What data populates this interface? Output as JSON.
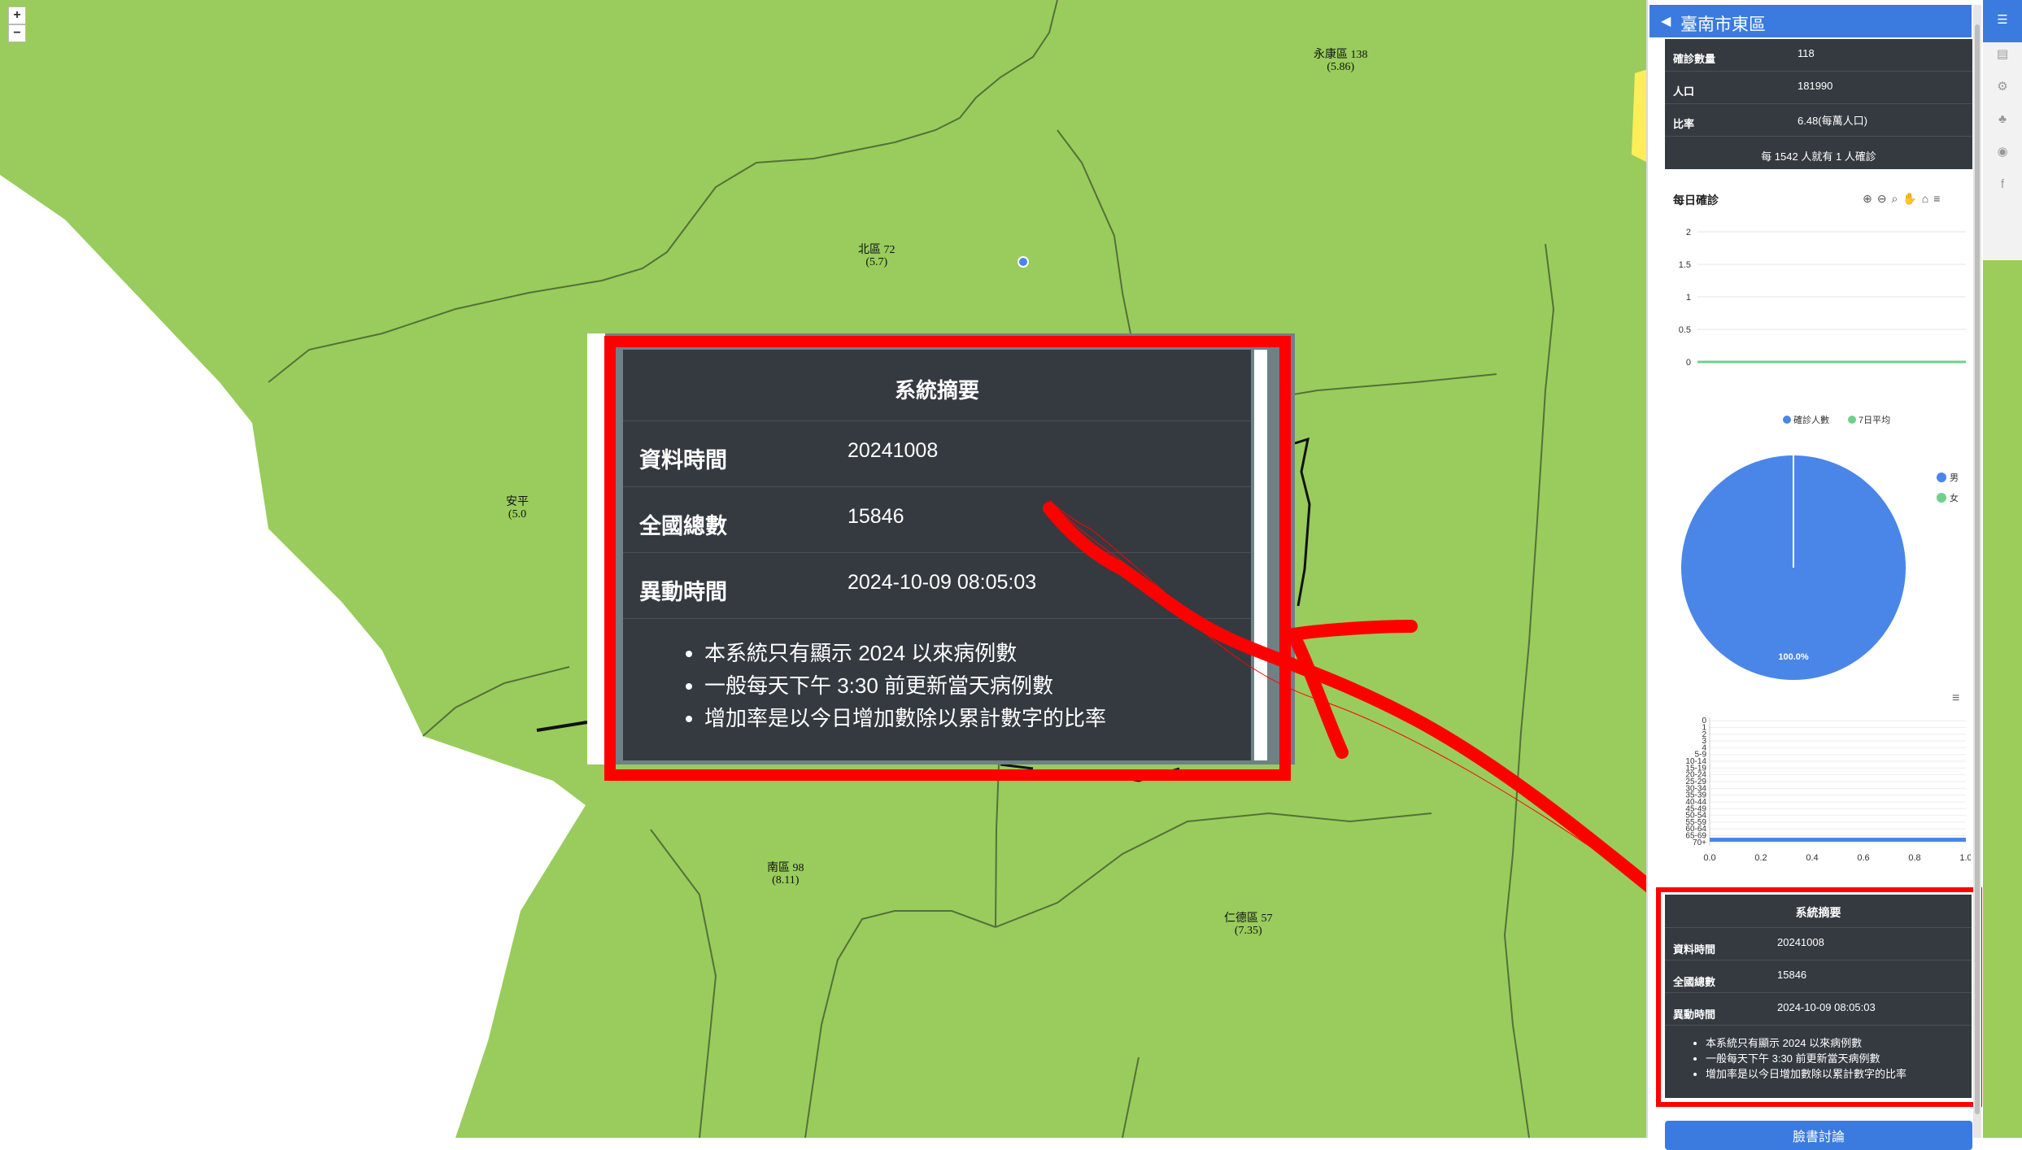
{
  "map": {
    "zoom_in": "+",
    "zoom_out": "−",
    "labels": [
      {
        "id": "yongkang",
        "text": "永康區 138\n(5.86)"
      },
      {
        "id": "north",
        "text": "北區 72\n(5.7)"
      },
      {
        "id": "anping",
        "text": "安平\n(5.0"
      },
      {
        "id": "south",
        "text": "南區 98\n(8.11)"
      },
      {
        "id": "rende",
        "text": "仁德區 57\n(7.35)"
      }
    ],
    "colors": {
      "land": "#99cc5c",
      "sea": "#ffffff",
      "boundary": "#55703a"
    }
  },
  "summary": {
    "title": "系統摘要",
    "rows": [
      {
        "key": "資料時間",
        "value": "20241008"
      },
      {
        "key": "全國總數",
        "value": "15846"
      },
      {
        "key": "異動時間",
        "value": "2024-10-09 08:05:03"
      }
    ],
    "notes": [
      "本系統只有顯示 2024 以來病例數",
      "一般每天下午 3:30 前更新當天病例數",
      "增加率是以今日增加數除以累計數字的比率"
    ]
  },
  "sidebar": {
    "title": "臺南市東區",
    "stats": [
      {
        "key": "確診數量",
        "value": "118"
      },
      {
        "key": "人口",
        "value": "181990"
      },
      {
        "key": "比率",
        "value": "6.48(每萬人口)"
      }
    ],
    "ratio_text": "每 1542 人就有 1 人確診",
    "bottom_button": "臉書討論"
  },
  "chart_data": [
    {
      "type": "line",
      "title": "每日確診",
      "ylim": [
        0,
        2
      ],
      "yticks": [
        "0",
        "0.5",
        "1",
        "1.5",
        "2"
      ],
      "series": [
        {
          "name": "確診人數",
          "color": "#4a86e8"
        },
        {
          "name": "7日平均",
          "color": "#6fd08c"
        }
      ],
      "legend_position": "bottom"
    },
    {
      "type": "pie",
      "series": [
        {
          "name": "男",
          "value": 100.0,
          "color": "#4a86e8"
        },
        {
          "name": "女",
          "value": 0.0,
          "color": "#6fd08c"
        }
      ],
      "slice_label": "100.0%",
      "legend_position": "right"
    },
    {
      "type": "bar",
      "orientation": "horizontal",
      "categories": [
        "0",
        "1",
        "2",
        "3",
        "4",
        "5-9",
        "10-14",
        "15-19",
        "20-24",
        "25-29",
        "30-34",
        "35-39",
        "40-44",
        "45-49",
        "50-54",
        "55-59",
        "60-64",
        "65-69",
        "70+"
      ],
      "xticks": [
        "0.0",
        "0.2",
        "0.4",
        "0.6",
        "0.8",
        "1.0"
      ],
      "xlim": [
        0,
        1.0
      ],
      "color": "#4a86e8"
    }
  ],
  "colors": {
    "accent": "#3b7be0",
    "panel": "#343a40",
    "highlight": "#ff0000"
  }
}
